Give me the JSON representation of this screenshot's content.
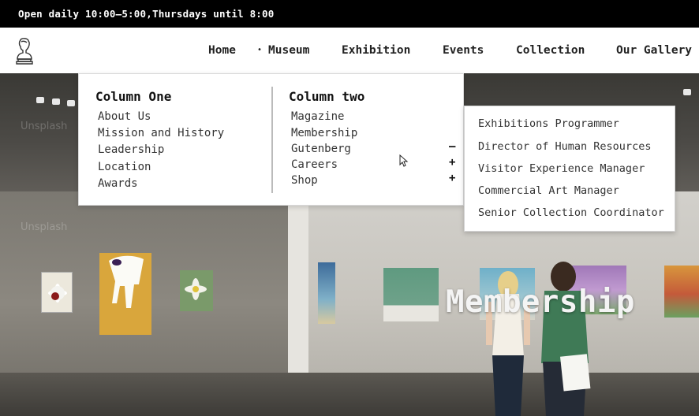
{
  "topbar": {
    "hours": "Open daily 10:00–5:00,Thursdays until 8:00"
  },
  "header": {
    "logo_icon": "bust-statue-icon",
    "nav": [
      {
        "label": "Home"
      },
      {
        "label": "Museum"
      },
      {
        "label": "Exhibition"
      },
      {
        "label": "Events"
      },
      {
        "label": "Collection"
      },
      {
        "label": "Our Gallery"
      }
    ],
    "active_bullet": "•"
  },
  "mega_menu": {
    "column_one": {
      "title": "Column One",
      "items": [
        "About Us",
        "Mission and History",
        "Leadership",
        "Location",
        "Awards"
      ]
    },
    "column_two": {
      "title": "Column two",
      "items": [
        "Magazine",
        "Membership",
        "Gutenberg",
        "Careers",
        "Shop"
      ],
      "toggles": [
        "–",
        "+",
        "+"
      ]
    }
  },
  "submenu": {
    "items": [
      "Exhibitions Programmer",
      "Director of Human Resources",
      "Visitor Experience Manager",
      "Commercial Art Manager",
      "Senior Collection Coordinator"
    ]
  },
  "hero": {
    "title": "Membership",
    "watermark": "Unsplash"
  },
  "colors": {
    "topbar_bg": "#000000",
    "header_bg": "#ffffff",
    "text_dark": "#222222"
  }
}
